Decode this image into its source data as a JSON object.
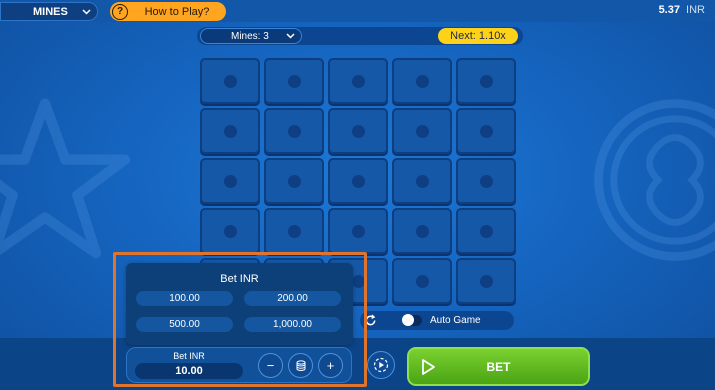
{
  "topbar": {
    "game_name": "MINES",
    "how_to_play": "How to Play?",
    "help_glyph": "?",
    "balance_amount": "5.37",
    "balance_currency": "INR"
  },
  "game": {
    "mines_label": "Mines: 3",
    "next_multiplier": "Next: 1.10x",
    "grid_rows": 5,
    "grid_cols": 5
  },
  "bet_popup": {
    "title": "Bet INR",
    "options": [
      "100.00",
      "200.00",
      "500.00",
      "1,000.00"
    ]
  },
  "controls": {
    "auto_game_label": "Auto Game",
    "auto_game_enabled": false,
    "bet_input_label": "Bet INR",
    "bet_value": "10.00",
    "minus": "−",
    "plus": "+",
    "bet_button": "BET"
  },
  "colors": {
    "accent_orange": "#ffa51f",
    "next_yellow": "#ffd21a",
    "bet_green": "#5cb81e",
    "highlight": "#e1742c"
  },
  "icons": [
    "chevron-down-icon",
    "help-icon",
    "refresh-icon",
    "play-icon",
    "coin-stack-icon",
    "star-icon",
    "circle-emblem-icon"
  ]
}
